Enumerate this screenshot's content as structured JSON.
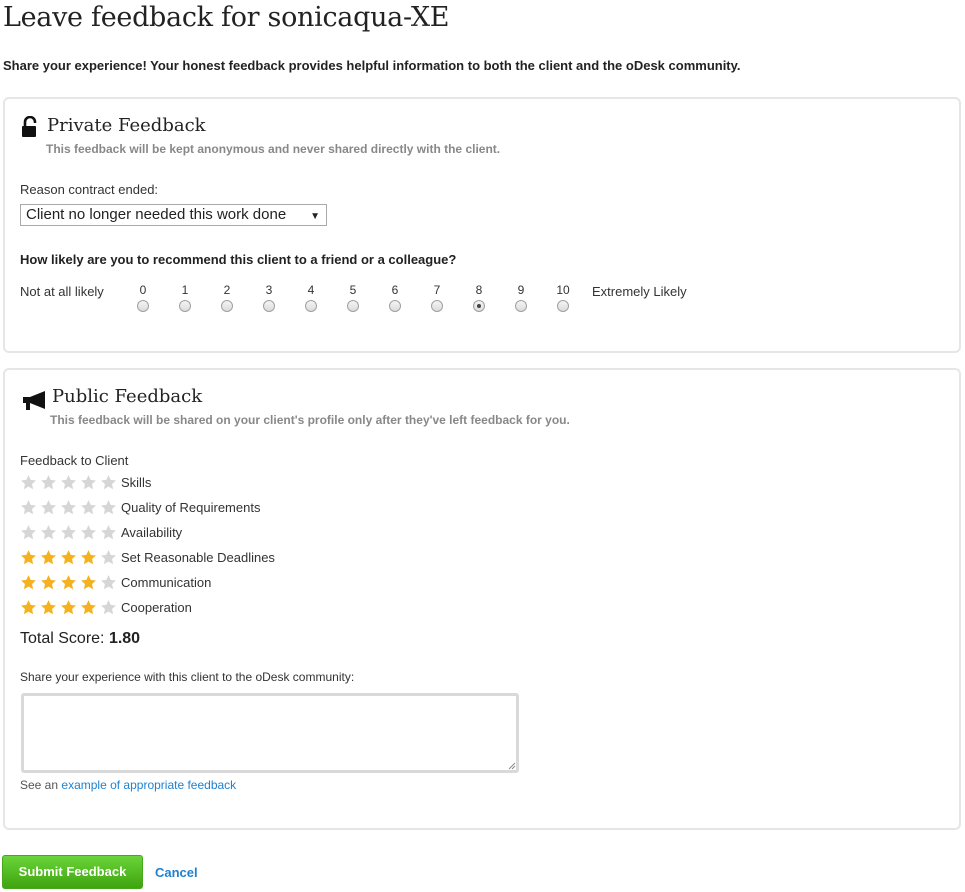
{
  "page": {
    "title": "Leave feedback for sonicaqua-XE",
    "intro": "Share your experience! Your honest feedback provides helpful information to both the client and the oDesk community."
  },
  "private": {
    "icon": "lock-icon",
    "title": "Private Feedback",
    "subtitle": "This feedback will be kept anonymous and never shared directly with the client.",
    "reason_label": "Reason contract ended:",
    "reason_value": "Client no longer needed this work done",
    "question": "How likely are you to recommend this client to a friend or a colleague?",
    "scale_left": "Not at all likely",
    "scale_right": "Extremely Likely",
    "scale": [
      "0",
      "1",
      "2",
      "3",
      "4",
      "5",
      "6",
      "7",
      "8",
      "9",
      "10"
    ],
    "selected": "8"
  },
  "public": {
    "icon": "megaphone-icon",
    "title": "Public Feedback",
    "subtitle": "This feedback will be shared on your client's profile only after they've left feedback for you.",
    "feedback_label": "Feedback to Client",
    "ratings": [
      {
        "label": "Skills",
        "stars": 0
      },
      {
        "label": "Quality of Requirements",
        "stars": 0
      },
      {
        "label": "Availability",
        "stars": 0
      },
      {
        "label": "Set Reasonable Deadlines",
        "stars": 4
      },
      {
        "label": "Communication",
        "stars": 4
      },
      {
        "label": "Cooperation",
        "stars": 4
      }
    ],
    "max_stars": 5,
    "total_label": "Total Score:",
    "total_value": "1.80",
    "comment_label": "Share your experience with this client to the oDesk community:",
    "comment_value": "",
    "hint_prefix": "See an",
    "hint_link": "example of appropriate feedback"
  },
  "actions": {
    "submit": "Submit Feedback",
    "cancel": "Cancel"
  },
  "colors": {
    "star_on": "#f5b21e",
    "star_off": "#d6d6d6",
    "link": "#1f82d1",
    "submit": "#4cb81a"
  }
}
